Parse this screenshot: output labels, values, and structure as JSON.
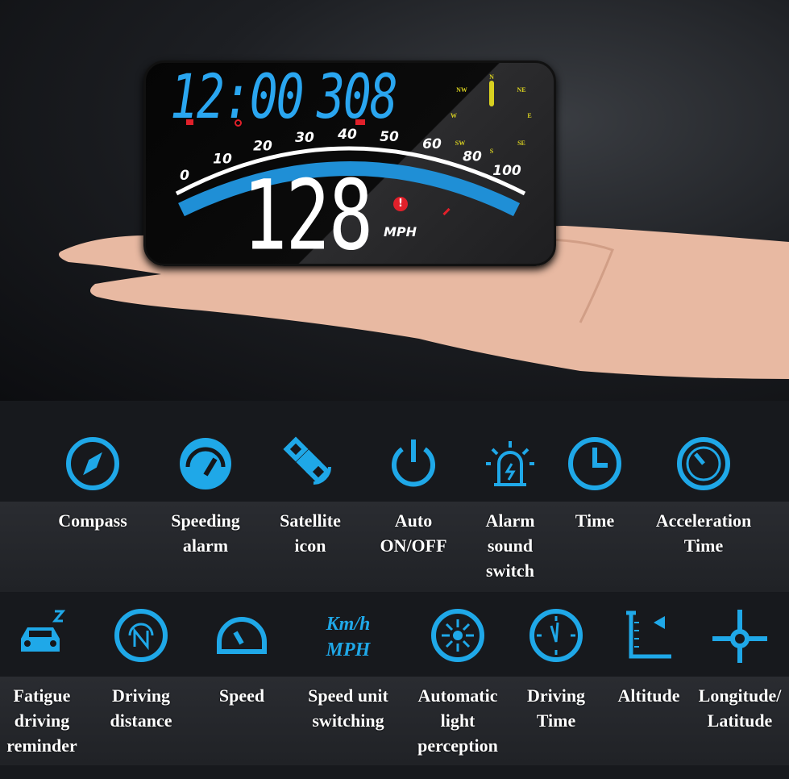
{
  "device": {
    "time": "12:00",
    "altitude": "308",
    "speed": "128",
    "speed_unit": "MPH",
    "compass": [
      "N",
      "NE",
      "E",
      "SE",
      "S",
      "SW",
      "W",
      "NW"
    ],
    "scale": [
      "0",
      "10",
      "20",
      "30",
      "40",
      "50",
      "60",
      "80",
      "100"
    ]
  },
  "colors": {
    "accent": "#1fa8e8",
    "hud_blue": "#2aa6f0",
    "compass": "#d8d020",
    "warning": "#e0202a"
  },
  "features_row1": [
    {
      "icon": "compass-icon",
      "label": "Compass"
    },
    {
      "icon": "speedometer-icon",
      "label": "Speeding\nalarm"
    },
    {
      "icon": "satellite-icon",
      "label": "Satellite\nicon"
    },
    {
      "icon": "power-icon",
      "label": "Auto\nON/OFF"
    },
    {
      "icon": "alarm-light-icon",
      "label": "Alarm\nsound\nswitch"
    },
    {
      "icon": "clock-icon",
      "label": "Time"
    },
    {
      "icon": "gauge-icon",
      "label": "Acceleration\nTime"
    }
  ],
  "features_row2": [
    {
      "icon": "sleepy-car-icon",
      "label": "Fatigue\ndriving\nreminder"
    },
    {
      "icon": "distance-n-icon",
      "label": "Driving\ndistance"
    },
    {
      "icon": "speed-gauge-icon",
      "label": "Speed"
    },
    {
      "icon": "unit-text-icon",
      "label": "Speed unit\nswitching",
      "unit_top": "Km/h",
      "unit_bottom": "MPH"
    },
    {
      "icon": "light-sensor-icon",
      "label": "Automatic\nlight\nperception"
    },
    {
      "icon": "stopwatch-icon",
      "label": "Driving\nTime"
    },
    {
      "icon": "altitude-icon",
      "label": "Altitude"
    },
    {
      "icon": "crosshair-icon",
      "label": "Longitude/\nLatitude"
    }
  ]
}
